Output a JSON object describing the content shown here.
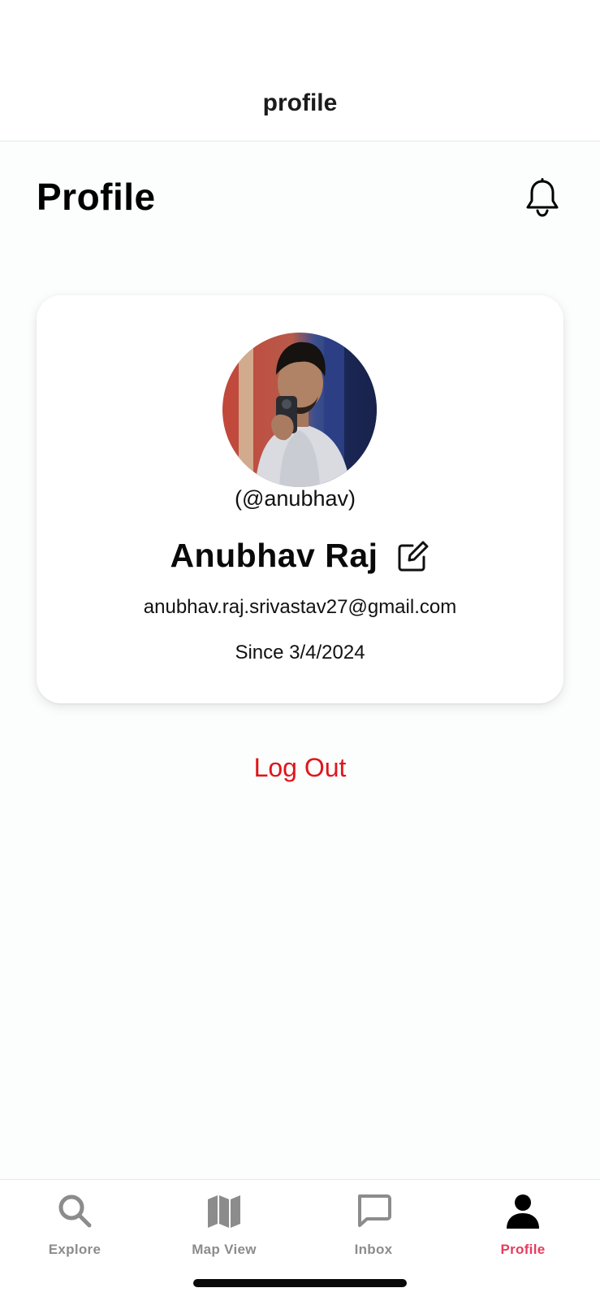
{
  "header": {
    "title": "profile"
  },
  "page": {
    "heading": "Profile",
    "notification_icon": "bell-icon"
  },
  "profile": {
    "avatar_icon": "avatar-photo",
    "username": "(@anubhav)",
    "full_name": "Anubhav Raj",
    "edit_icon": "edit-icon",
    "email": "anubhav.raj.srivastav27@gmail.com",
    "since": "Since 3/4/2024"
  },
  "actions": {
    "logout_label": "Log Out",
    "logout_color": "#e0151c"
  },
  "tab_bar": {
    "active_color": "#e83b5d",
    "inactive_color": "#8c8c8c",
    "tabs": [
      {
        "label": "Explore",
        "icon": "search-icon",
        "active": false
      },
      {
        "label": "Map View",
        "icon": "map-icon",
        "active": false
      },
      {
        "label": "Inbox",
        "icon": "chat-icon",
        "active": false
      },
      {
        "label": "Profile",
        "icon": "person-icon",
        "active": true
      }
    ]
  }
}
